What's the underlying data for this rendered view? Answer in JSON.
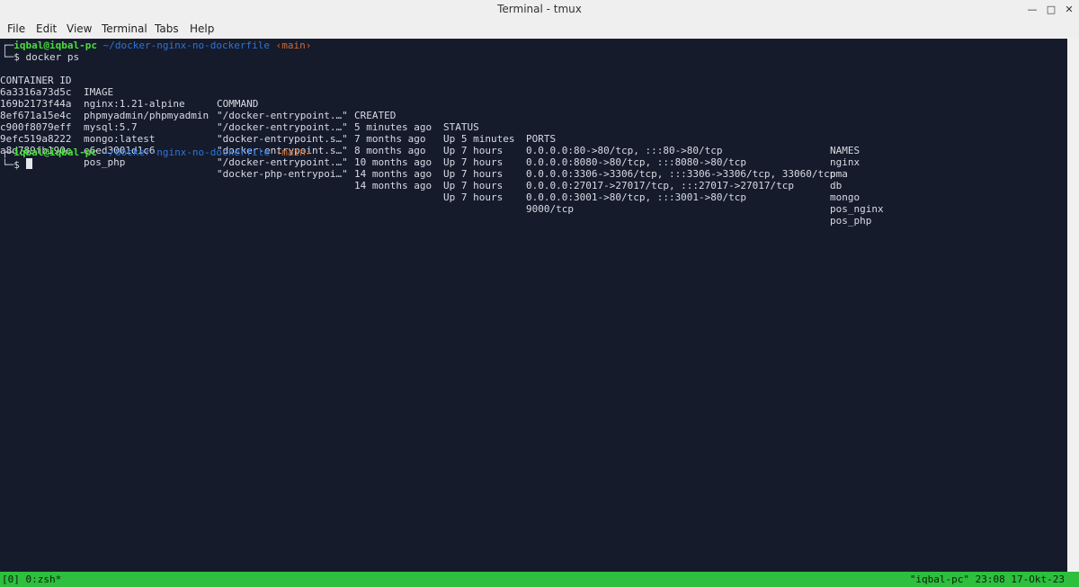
{
  "window": {
    "title": "Terminal - tmux"
  },
  "menu": [
    "File",
    "Edit",
    "View",
    "Terminal",
    "Tabs",
    "Help"
  ],
  "prompt1": {
    "user": "iqbal@iqbal-pc",
    "path": "~/docker-nginx-no-dockerfile",
    "branch": "‹main›"
  },
  "command": "docker ps",
  "ps": {
    "headers": [
      "CONTAINER ID",
      "IMAGE",
      "COMMAND",
      "CREATED",
      "STATUS",
      "PORTS",
      "NAMES"
    ],
    "rows": [
      [
        "6a3316a73d5c",
        "nginx:1.21-alpine",
        "\"/docker-entrypoint.…\"",
        "5 minutes ago",
        "Up 5 minutes",
        "0.0.0.0:80->80/tcp, :::80->80/tcp",
        "nginx"
      ],
      [
        "169b2173f44a",
        "phpmyadmin/phpmyadmin",
        "\"/docker-entrypoint.…\"",
        "7 months ago",
        "Up 7 hours",
        "0.0.0.0:8080->80/tcp, :::8080->80/tcp",
        "pma"
      ],
      [
        "8ef671a15e4c",
        "mysql:5.7",
        "\"docker-entrypoint.s…\"",
        "8 months ago",
        "Up 7 hours",
        "0.0.0.0:3306->3306/tcp, :::3306->3306/tcp, 33060/tcp",
        "db"
      ],
      [
        "c900f8079eff",
        "mongo:latest",
        "\"docker-entrypoint.s…\"",
        "10 months ago",
        "Up 7 hours",
        "0.0.0.0:27017->27017/tcp, :::27017->27017/tcp",
        "mongo"
      ],
      [
        "9efc519a8222",
        "e6ed3001d1c6",
        "\"/docker-entrypoint.…\"",
        "14 months ago",
        "Up 7 hours",
        "0.0.0.0:3001->80/tcp, :::3001->80/tcp",
        "pos_nginx"
      ],
      [
        "a8d789fb190e",
        "pos_php",
        "\"docker-php-entrypoi…\"",
        "14 months ago",
        "Up 7 hours",
        "9000/tcp",
        "pos_php"
      ]
    ]
  },
  "prompt2": {
    "user": "iqbal@iqbal-pc",
    "path": "~/docker-nginx-no-dockerfile",
    "branch": "‹main›"
  },
  "statusbar": {
    "left": "[0] 0:zsh*",
    "right": "\"iqbal-pc\" 23:08 17-Okt-23"
  },
  "colors": {
    "terminal_bg": "#151b2b",
    "user": "#4ade3b",
    "path": "#2f73d6",
    "branch": "#cc6c33",
    "status_bg": "#2dbf3d"
  }
}
